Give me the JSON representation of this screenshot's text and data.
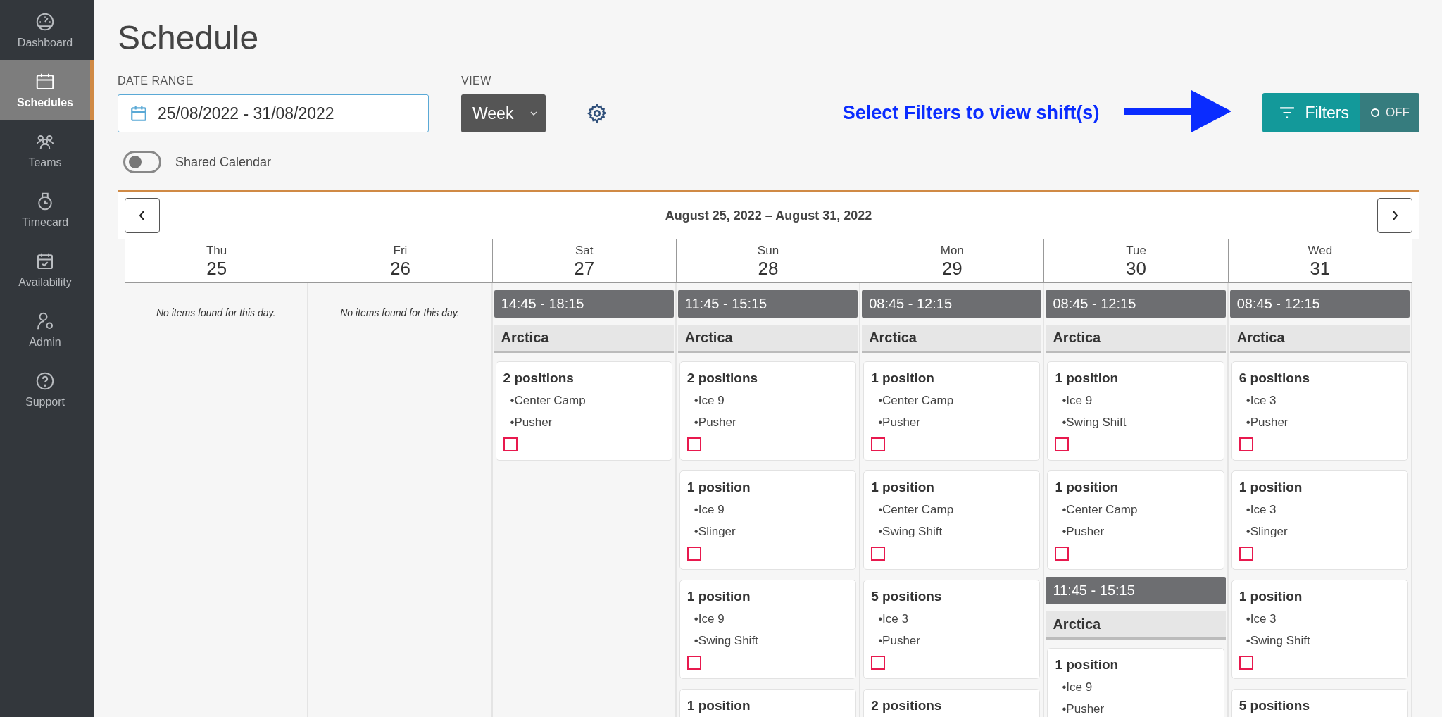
{
  "sidebar": {
    "items": [
      {
        "label": "Dashboard",
        "selected": false
      },
      {
        "label": "Schedules",
        "selected": true
      },
      {
        "label": "Teams",
        "selected": false
      },
      {
        "label": "Timecard",
        "selected": false
      },
      {
        "label": "Availability",
        "selected": false
      },
      {
        "label": "Admin",
        "selected": false
      },
      {
        "label": "Support",
        "selected": false
      }
    ]
  },
  "page_title": "Schedule",
  "date_range": {
    "label": "DATE RANGE",
    "value": "25/08/2022 - 31/08/2022"
  },
  "view": {
    "label": "VIEW",
    "value": "Week"
  },
  "annotation": "Select Filters to view shift(s)",
  "filters": {
    "label": "Filters",
    "on": false,
    "state_text": "OFF"
  },
  "shared_calendar": {
    "label": "Shared Calendar",
    "on": false
  },
  "calendar": {
    "range_title": "August 25, 2022 – August 31, 2022",
    "days": [
      {
        "dow": "Thu",
        "date": "25",
        "empty_text": "No items found for this day."
      },
      {
        "dow": "Fri",
        "date": "26",
        "empty_text": "No items found for this day."
      },
      {
        "dow": "Sat",
        "date": "27",
        "shifts": [
          {
            "time": "14:45 - 18:15",
            "location": "Arctica",
            "positions": [
              {
                "title": "2 positions",
                "items": [
                  "•Center Camp",
                  "•Pusher"
                ],
                "checked": false
              }
            ]
          }
        ]
      },
      {
        "dow": "Sun",
        "date": "28",
        "shifts": [
          {
            "time": "11:45 - 15:15",
            "location": "Arctica",
            "positions": [
              {
                "title": "2 positions",
                "items": [
                  "•Ice 9",
                  "•Pusher"
                ],
                "checked": false
              },
              {
                "title": "1 position",
                "items": [
                  "•Ice 9",
                  "•Slinger"
                ],
                "checked": false
              },
              {
                "title": "1 position",
                "items": [
                  "•Ice 9",
                  "•Swing Shift"
                ],
                "checked": false
              },
              {
                "title": "1 position"
              }
            ]
          }
        ]
      },
      {
        "dow": "Mon",
        "date": "29",
        "shifts": [
          {
            "time": "08:45 - 12:15",
            "location": "Arctica",
            "positions": [
              {
                "title": "1 position",
                "items": [
                  "•Center Camp",
                  "•Pusher"
                ],
                "checked": false
              },
              {
                "title": "1 position",
                "items": [
                  "•Center Camp",
                  "•Swing Shift"
                ],
                "checked": false
              },
              {
                "title": "5 positions",
                "items": [
                  "•Ice 3",
                  "•Pusher"
                ],
                "checked": false
              },
              {
                "title": "2 positions"
              }
            ]
          }
        ]
      },
      {
        "dow": "Tue",
        "date": "30",
        "shifts": [
          {
            "time": "08:45 - 12:15",
            "location": "Arctica",
            "positions": [
              {
                "title": "1 position",
                "items": [
                  "•Ice 9",
                  "•Swing Shift"
                ],
                "checked": false
              },
              {
                "title": "1 position",
                "items": [
                  "•Center Camp",
                  "•Pusher"
                ],
                "checked": false
              }
            ]
          },
          {
            "time": "11:45 - 15:15",
            "location": "Arctica",
            "positions": [
              {
                "title": "1 position",
                "items": [
                  "•Ice 9",
                  "•Pusher"
                ]
              }
            ]
          }
        ]
      },
      {
        "dow": "Wed",
        "date": "31",
        "shifts": [
          {
            "time": "08:45 - 12:15",
            "location": "Arctica",
            "positions": [
              {
                "title": "6 positions",
                "items": [
                  "•Ice 3",
                  "•Pusher"
                ],
                "checked": false
              },
              {
                "title": "1 position",
                "items": [
                  "•Ice 3",
                  "•Slinger"
                ],
                "checked": false
              },
              {
                "title": "1 position",
                "items": [
                  "•Ice 3",
                  "•Swing Shift"
                ],
                "checked": false
              },
              {
                "title": "5 positions"
              }
            ]
          }
        ]
      }
    ]
  }
}
